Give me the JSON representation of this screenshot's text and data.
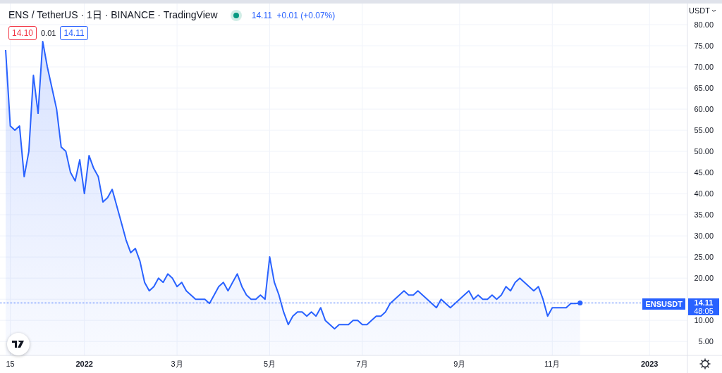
{
  "header": {
    "symbol": "ENS / TetherUS · 1日 · BINANCE · TradingView",
    "market_open": true,
    "price": "14.11",
    "change": "+0.01 (+0.07%)"
  },
  "quote": {
    "bid": "14.10",
    "spread": "0.01",
    "ask": "14.11"
  },
  "currency_menu": "USDT",
  "price_label": {
    "price": "14.11",
    "countdown": "48:05"
  },
  "chart_data": {
    "type": "area",
    "grid": true,
    "ylim": [
      1.7,
      85
    ],
    "yticks": [
      {
        "value": 5,
        "label": "5.00"
      },
      {
        "value": 10,
        "label": "10.00"
      },
      {
        "value": 20,
        "label": "20.00"
      },
      {
        "value": 25,
        "label": "25.00"
      },
      {
        "value": 30,
        "label": "30.00"
      },
      {
        "value": 35,
        "label": "35.00"
      },
      {
        "value": 40,
        "label": "40.00"
      },
      {
        "value": 45,
        "label": "45.00"
      },
      {
        "value": 50,
        "label": "50.00"
      },
      {
        "value": 55,
        "label": "55.00"
      },
      {
        "value": 60,
        "label": "60.00"
      },
      {
        "value": 65,
        "label": "65.00"
      },
      {
        "value": 70,
        "label": "70.00"
      },
      {
        "value": 75,
        "label": "75.00"
      },
      {
        "value": 80,
        "label": "80.00"
      }
    ],
    "categories": [
      null,
      "15",
      null,
      null,
      null,
      null,
      null,
      null,
      null,
      null,
      null,
      null,
      null,
      null,
      null,
      null,
      null,
      "2022",
      null,
      null,
      null,
      null,
      null,
      null,
      null,
      null,
      null,
      null,
      null,
      null,
      null,
      null,
      null,
      null,
      null,
      null,
      null,
      "3月",
      null,
      null,
      null,
      null,
      null,
      null,
      null,
      null,
      null,
      null,
      null,
      null,
      null,
      null,
      null,
      null,
      null,
      null,
      null,
      "5月",
      null,
      null,
      null,
      null,
      null,
      null,
      null,
      null,
      null,
      null,
      null,
      null,
      null,
      null,
      null,
      null,
      null,
      null,
      null,
      "7月",
      null,
      null,
      null,
      null,
      null,
      null,
      null,
      null,
      null,
      null,
      null,
      null,
      null,
      null,
      null,
      null,
      null,
      null,
      null,
      null,
      "9月",
      null,
      null,
      null,
      null,
      null,
      null,
      null,
      null,
      null,
      null,
      null,
      null,
      null,
      null,
      null,
      null,
      null,
      null,
      null,
      "11月",
      null,
      null,
      null,
      null,
      null,
      null,
      null,
      null,
      null,
      null,
      null,
      null,
      null,
      null,
      null,
      null,
      null,
      null,
      null,
      null,
      "2023"
    ],
    "series": [
      {
        "name": "ENSUSDT",
        "color": "#2962ff",
        "values": [
          74,
          56,
          55,
          56,
          44,
          50,
          68,
          59,
          76,
          70,
          65,
          60,
          51,
          50,
          45,
          43,
          48,
          40,
          49,
          46,
          44,
          38,
          39,
          41,
          37,
          33,
          29,
          26,
          27,
          24,
          19,
          17,
          18,
          20,
          19,
          21,
          20,
          18,
          19,
          17,
          16,
          15,
          15,
          15,
          14,
          16,
          18,
          19,
          17,
          19,
          21,
          18,
          16,
          15,
          15,
          16,
          15,
          25,
          19,
          16,
          12,
          9,
          11,
          12,
          12,
          11,
          12,
          11,
          13,
          10,
          9,
          8,
          9,
          9,
          9,
          10,
          10,
          9,
          9,
          10,
          11,
          11,
          12,
          14,
          15,
          16,
          17,
          16,
          16,
          17,
          16,
          15,
          14,
          13,
          15,
          14,
          13,
          14,
          15,
          16,
          17,
          15,
          16,
          15,
          15,
          16,
          15,
          16,
          18,
          17,
          19,
          20,
          19,
          18,
          17,
          18,
          15,
          11,
          13,
          13,
          13,
          13,
          14,
          14,
          14.1,
          null,
          null,
          null,
          null,
          null,
          null,
          null,
          null,
          null,
          null,
          null,
          null,
          null,
          null,
          null
        ]
      }
    ]
  }
}
